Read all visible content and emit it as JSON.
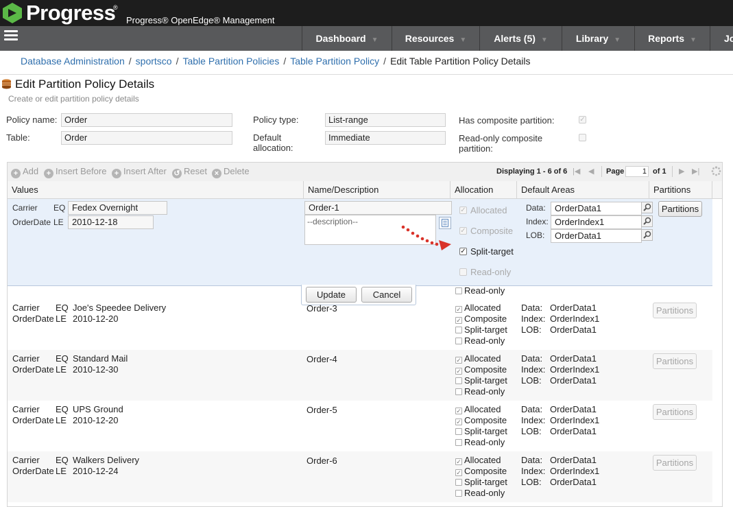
{
  "app": {
    "brand": "Progress",
    "product": "Progress® OpenEdge® Management"
  },
  "nav": [
    "Dashboard",
    "Resources",
    "Alerts (5)",
    "Library",
    "Reports",
    "Jo"
  ],
  "breadcrumb": [
    "Database Administration",
    "sportsco",
    "Table Partition Policies",
    "Table Partition Policy",
    "Edit Table Partition Policy Details"
  ],
  "page": {
    "title": "Edit Partition Policy Details",
    "subtitle": "Create or edit partition policy details"
  },
  "form": {
    "policy_name_label": "Policy name:",
    "policy_name": "Order",
    "table_label": "Table:",
    "table": "Order",
    "policy_type_label": "Policy type:",
    "policy_type": "List-range",
    "default_allocation_label_1": "Default",
    "default_allocation_label_2": "allocation:",
    "default_allocation": "Immediate",
    "composite_label": "Has composite partition:",
    "composite_checked": true,
    "readonly_label_1": "Read-only composite",
    "readonly_label_2": "partition:",
    "readonly_checked": false
  },
  "toolbar": {
    "add": "Add",
    "insert_before": "Insert Before",
    "insert_after": "Insert After",
    "reset": "Reset",
    "delete": "Delete",
    "displaying": "Displaying 1 - 6 of 6",
    "page_label": "Page",
    "page": "1",
    "of": "of 1"
  },
  "columns": [
    "Values",
    "Name/Description",
    "Allocation",
    "Default Areas",
    "Partitions"
  ],
  "edit_row": {
    "carrier_label": "Carrier",
    "carrier_op": "EQ",
    "carrier_value": "Fedex Overnight",
    "date_label": "OrderDate",
    "date_op": "LE",
    "date_value": "2010-12-18",
    "name": "Order-1",
    "description_placeholder": "--description--",
    "alloc": {
      "allocated": "Allocated",
      "composite": "Composite",
      "split": "Split-target",
      "readonly": "Read-only"
    },
    "areas": {
      "data_label": "Data:",
      "data": "OrderData1",
      "index_label": "Index:",
      "index": "OrderIndex1",
      "lob_label": "LOB:",
      "lob": "OrderData1"
    },
    "partitions_button": "Partitions",
    "update_button": "Update",
    "cancel_button": "Cancel",
    "readonly_below": "Read-only"
  },
  "rows": [
    {
      "carrier": "Joe's Speedee Delivery",
      "date": "2010-12-20",
      "name": "Order-3"
    },
    {
      "carrier": "Standard Mail",
      "date": "2010-12-30",
      "name": "Order-4"
    },
    {
      "carrier": "UPS Ground",
      "date": "2010-12-20",
      "name": "Order-5"
    },
    {
      "carrier": "Walkers Delivery",
      "date": "2010-12-24",
      "name": "Order-6"
    }
  ],
  "row_labels": {
    "carrier": "Carrier",
    "eq": "EQ",
    "orderdate": "OrderDate",
    "le": "LE",
    "allocated": "Allocated",
    "composite": "Composite",
    "split": "Split-target",
    "readonly": "Read-only",
    "data_label": "Data:",
    "index_label": "Index:",
    "lob_label": "LOB:",
    "data": "OrderData1",
    "index": "OrderIndex1",
    "lob": "OrderData1",
    "partitions": "Partitions"
  },
  "colors": {
    "brand_green": "#5bb947",
    "nav_bg": "#58595b",
    "link": "#2f6fad",
    "edit_row_bg": "#e8f0fa",
    "annotation_red": "#d9332a"
  }
}
